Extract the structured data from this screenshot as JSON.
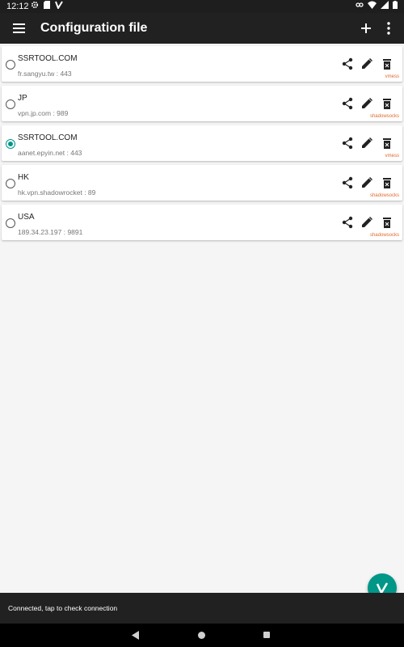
{
  "status_bar": {
    "time": "12:12"
  },
  "app_bar": {
    "title": "Configuration file"
  },
  "servers": [
    {
      "name": "SSRTOOL.COM",
      "address": "fr.sangyu.tw : 443",
      "protocol": "vmess",
      "selected": false
    },
    {
      "name": "JP",
      "address": "vpn.jp.com : 989",
      "protocol": "shadowsocks",
      "selected": false
    },
    {
      "name": "SSRTOOL.COM",
      "address": "aanet.epyin.net : 443",
      "protocol": "vmess",
      "selected": true
    },
    {
      "name": "HK",
      "address": "hk.vpn.shadowrocket : 89",
      "protocol": "shadowsocks",
      "selected": false
    },
    {
      "name": "USA",
      "address": "189.34.23.197 : 9891",
      "protocol": "shadowsocks",
      "selected": false
    }
  ],
  "bottom_status": {
    "text": "Connected, tap to check connection"
  },
  "colors": {
    "accent": "#009688",
    "protocol": "#e06a2c",
    "app_bar": "#212121"
  },
  "icons": {
    "menu": "menu-icon",
    "add": "plus-icon",
    "more": "more-vert-icon",
    "share": "share-icon",
    "edit": "pencil-icon",
    "delete": "trash-icon",
    "fab": "v-logo-icon"
  }
}
